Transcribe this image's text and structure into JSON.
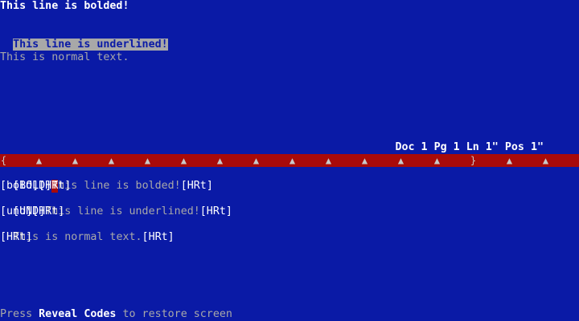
{
  "document": {
    "line1": "This line is bolded!",
    "line2": "This line is underlined!",
    "line3": "This is normal text."
  },
  "status": {
    "text": "Doc 1 Pg 1 Ln 1\" Pos 1\""
  },
  "ruler": {
    "left_margin": "{",
    "tab_stop": "▲",
    "right_margin": "}"
  },
  "reveal_codes": {
    "row1_code_open": "[BOLD]",
    "row1_cursor_char": "T",
    "row1_text": "his line is bolded!",
    "row1_hrt": "[HRt]",
    "row2": "[bold][HRt]",
    "row3_code_open": "[UND]",
    "row3_text": "This line is underlined!",
    "row3_hrt": "[HRt]",
    "row4": "[und][HRt]",
    "row5_text": "This is normal text.",
    "row5_hrt": "[HRt]",
    "row6": "[HRt]"
  },
  "prompt": {
    "prefix": "Press ",
    "key": "Reveal Codes",
    "suffix": " to restore screen"
  },
  "colors": {
    "background": "#0a1aa6",
    "ruler_bar": "#a80a0a",
    "underline_highlight": "#a8a8a8",
    "bold_text": "#ffffff",
    "normal_text": "#a8a8a8"
  }
}
